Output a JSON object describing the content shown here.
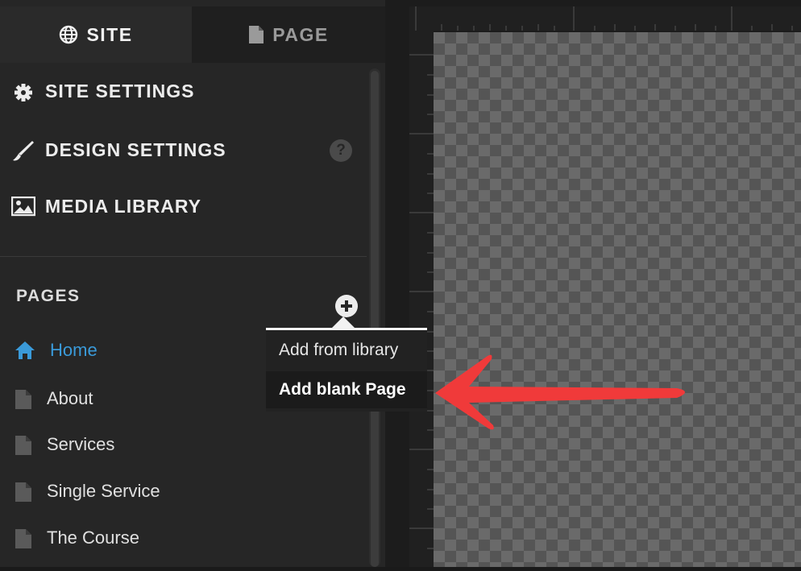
{
  "tabs": [
    {
      "label": "SITE",
      "icon": "globe-icon",
      "active": true
    },
    {
      "label": "PAGE",
      "icon": "document-icon",
      "active": false
    }
  ],
  "site_menu": [
    {
      "label": "SITE SETTINGS",
      "icon": "gear-icon"
    },
    {
      "label": "DESIGN SETTINGS",
      "icon": "brush-icon"
    },
    {
      "label": "MEDIA LIBRARY",
      "icon": "image-icon"
    }
  ],
  "help": {
    "label": "?"
  },
  "pages": {
    "heading": "PAGES",
    "items": [
      {
        "label": "Home",
        "icon": "home-icon",
        "active": true
      },
      {
        "label": "About",
        "icon": "page-icon"
      },
      {
        "label": "Services",
        "icon": "page-icon"
      },
      {
        "label": "Single Service",
        "icon": "page-icon"
      },
      {
        "label": "The Course",
        "icon": "page-icon"
      }
    ]
  },
  "add_menu": {
    "items": [
      "Add from library",
      "Add blank Page"
    ],
    "highlighted_index": 1
  },
  "colors": {
    "accent": "#3a9ad9",
    "annotation_arrow": "#f03a3a"
  }
}
